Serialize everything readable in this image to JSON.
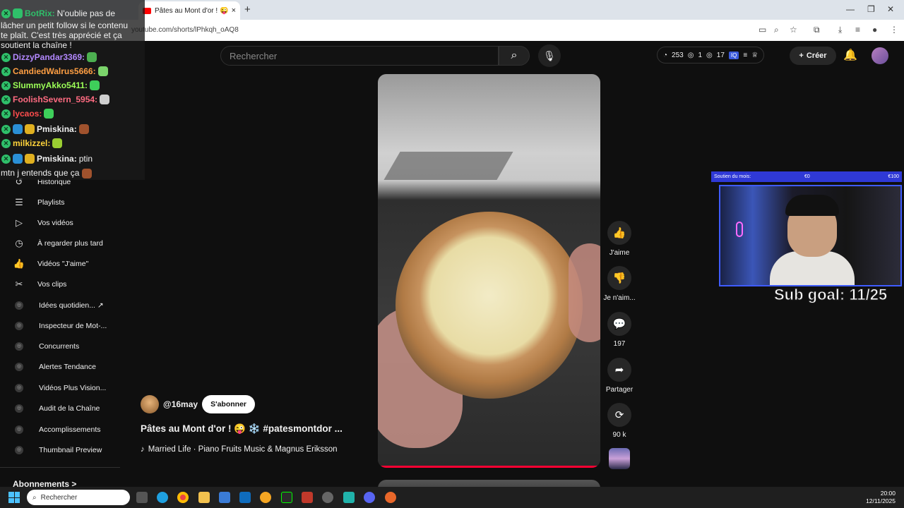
{
  "browser": {
    "tab_title": "Pâtes au Mont d'or ! 😜 ❄️",
    "tab_close": "×",
    "new_tab": "+",
    "url": "youtube.com/shorts/lPhkqh_oAQ8"
  },
  "header": {
    "search_placeholder": "Rechercher",
    "stats": {
      "views": "253",
      "likes": "1",
      "watchers": "17"
    },
    "create_label": "Créer"
  },
  "sidebar": {
    "items": [
      {
        "label": "Historique",
        "icon": "history-icon"
      },
      {
        "label": "Playlists",
        "icon": "playlist-icon"
      },
      {
        "label": "Vos vidéos",
        "icon": "video-icon"
      },
      {
        "label": "À regarder plus tard",
        "icon": "clock-icon"
      },
      {
        "label": "Vidéos \"J'aime\"",
        "icon": "thumbs-up-icon"
      },
      {
        "label": "Vos clips",
        "icon": "scissors-icon"
      }
    ],
    "extension_items": [
      {
        "label": "Idées quotidien...",
        "external": true
      },
      {
        "label": "Inspecteur de Mot-..."
      },
      {
        "label": "Concurrents"
      },
      {
        "label": "Alertes Tendance"
      },
      {
        "label": "Vidéos Plus Vision..."
      },
      {
        "label": "Audit de la Chaîne"
      },
      {
        "label": "Accomplissements"
      },
      {
        "label": "Thumbnail Preview"
      }
    ],
    "subscriptions_label": "Abonnements",
    "subscriptions_chevron": ">"
  },
  "short": {
    "channel": "@16may",
    "subscribe_label": "S'abonner",
    "title": "Pâtes au Mont d'or ! 😜 ❄️ #patesmontdor ...",
    "music": "Married Life · Piano Fruits Music & Magnus Eriksson",
    "progress": 1.0
  },
  "actions": {
    "like_label": "J'aime",
    "dislike_label": "Je n'aim...",
    "comments_count": "197",
    "share_label": "Partager",
    "remix_count": "90 k"
  },
  "chat": {
    "lines": [
      {
        "user": "BotRix:",
        "color": "#2fbf6a",
        "text": "N'oublie pas de"
      },
      {
        "user": "DizzyPandar3369:",
        "color": "#b388ff",
        "text": ""
      },
      {
        "user": "CandiedWalrus5666:",
        "color": "#ff9f43",
        "text": ""
      },
      {
        "user": "SlummyAkko5411:",
        "color": "#9cff57",
        "text": ""
      },
      {
        "user": "FoolishSevern_5954:",
        "color": "#ff6b81",
        "text": ""
      },
      {
        "user": "lycaos:",
        "color": "#ff4d4d",
        "text": ""
      },
      {
        "user": "Pmiskina:",
        "color": "#f1f1f1",
        "text": ""
      },
      {
        "user": "milkizzel:",
        "color": "#ffd43b",
        "text": ""
      },
      {
        "user": "Pmiskina:",
        "color": "#f1f1f1",
        "text": "ptin"
      }
    ],
    "wrap_botrix": [
      "lâcher un petit follow si le contenu",
      "te plaît. C'est très apprécié et ça",
      "soutient la chaîne !"
    ],
    "wrap_pmiskina": "mtn j entends que ça"
  },
  "stream": {
    "sub_panel_label": "Soutien du mois:",
    "sub_panel_mid": "€0",
    "sub_panel_max": "€100",
    "sub_goal": "Sub goal: 11/25"
  },
  "taskbar": {
    "search_placeholder": "Rechercher",
    "time": "20:00",
    "date": "12/11/2025"
  }
}
